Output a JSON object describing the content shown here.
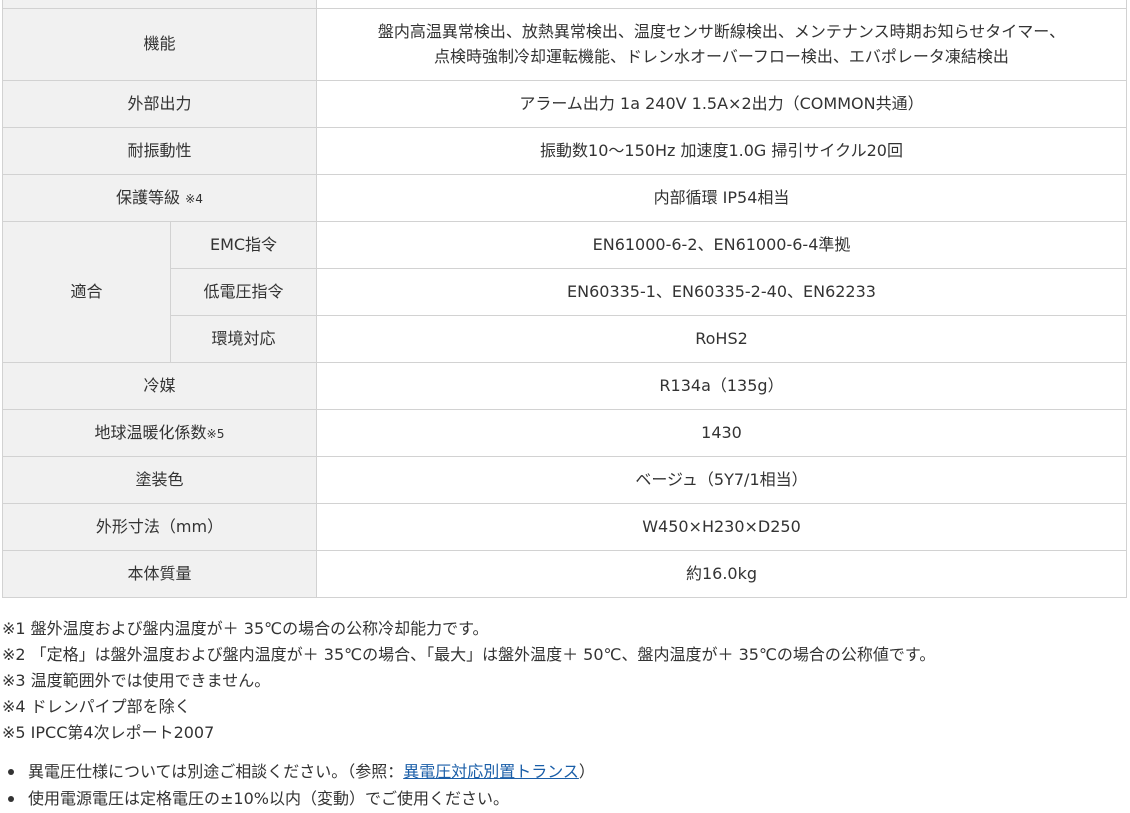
{
  "spec_table": {
    "rows": [
      {
        "header": "",
        "value": ""
      },
      {
        "header": "機能",
        "value_line1": "盤内高温異常検出、放熱異常検出、温度センサ断線検出、メンテナンス時期お知らせタイマー、",
        "value_line2": "点検時強制冷却運転機能、ドレン水オーバーフロー検出、エバポレータ凍結検出"
      },
      {
        "header": "外部出力",
        "value": "アラーム出力 1a 240V 1.5A×2出力（COMMON共通）"
      },
      {
        "header": "耐振動性",
        "value": "振動数10～150Hz 加速度1.0G 掃引サイクル20回"
      },
      {
        "header": "保護等級",
        "note": "※4",
        "value": "内部循環 IP54相当"
      },
      {
        "header": "適合",
        "sub": [
          {
            "header": "EMC指令",
            "value": "EN61000-6-2、EN61000-6-4準拠"
          },
          {
            "header": "低電圧指令",
            "value": "EN60335-1、EN60335-2-40、EN62233"
          },
          {
            "header": "環境対応",
            "value": "RoHS2"
          }
        ]
      },
      {
        "header": "冷媒",
        "value": "R134a（135g）"
      },
      {
        "header": "地球温暖化係数",
        "note": "※5",
        "value": "1430"
      },
      {
        "header": "塗装色",
        "value": "ベージュ（5Y7/1相当）"
      },
      {
        "header": "外形寸法（mm）",
        "value": "W450×H230×D250"
      },
      {
        "header": "本体質量",
        "value": "約16.0kg"
      }
    ]
  },
  "notes": [
    "※1 盤外温度および盤内温度が＋ 35℃の場合の公称冷却能力です。",
    "※2 「定格」は盤外温度および盤内温度が＋ 35℃の場合、「最大」は盤外温度＋ 50℃、盤内温度が＋ 35℃の場合の公称値です。",
    "※3 温度範囲外では使用できません。",
    "※4 ドレンパイプ部を除く",
    "※5 IPCC第4次レポート2007"
  ],
  "bullets": {
    "item1_prefix": "異電圧仕様については別途ご相談ください。（参照：",
    "item1_link": "異電圧対応別置トランス",
    "item1_suffix": "）",
    "item2": "使用電源電圧は定格電圧の±10%以内（変動）でご使用ください。"
  }
}
